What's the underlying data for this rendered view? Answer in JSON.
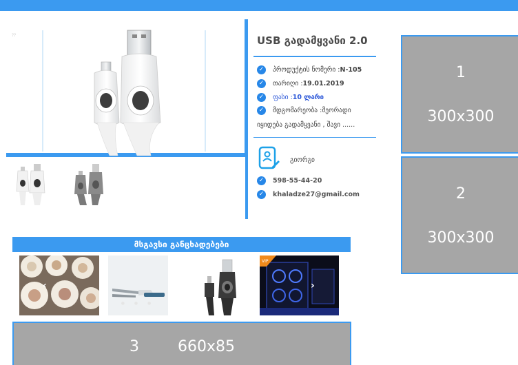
{
  "product": {
    "title": "USB გადამყვანი 2.0",
    "product_number": "პროდუქტის ნომერი : ",
    "product_number_value": "N-105",
    "date_label": "თარიღი : ",
    "date_value": "19.01.2019",
    "price_label": "ფასი : ",
    "price_value": "10 ლარი",
    "condition_label": "მდგომარეობა : ",
    "condition_value": "მეორადი",
    "desc_line2": "იყიდება გადამყვანი , შავი ......",
    "image_mark": "??"
  },
  "seller": {
    "name": "გიორგი",
    "phone": "598-55-44-20",
    "email": "khaladze27@gmail.com"
  },
  "ads": {
    "ad1_number": "1",
    "ad1_size": "300x300",
    "ad2_number": "2",
    "ad2_size": "300x300",
    "ad3_number": "3",
    "ad3_size": "660x85"
  },
  "similar": {
    "title": "მსგავსი განცხადებები",
    "vip_badge": "VIP"
  },
  "colors": {
    "accent": "#3b9af0",
    "check": "#2787e8",
    "ad_gray": "#a6a6a6"
  }
}
